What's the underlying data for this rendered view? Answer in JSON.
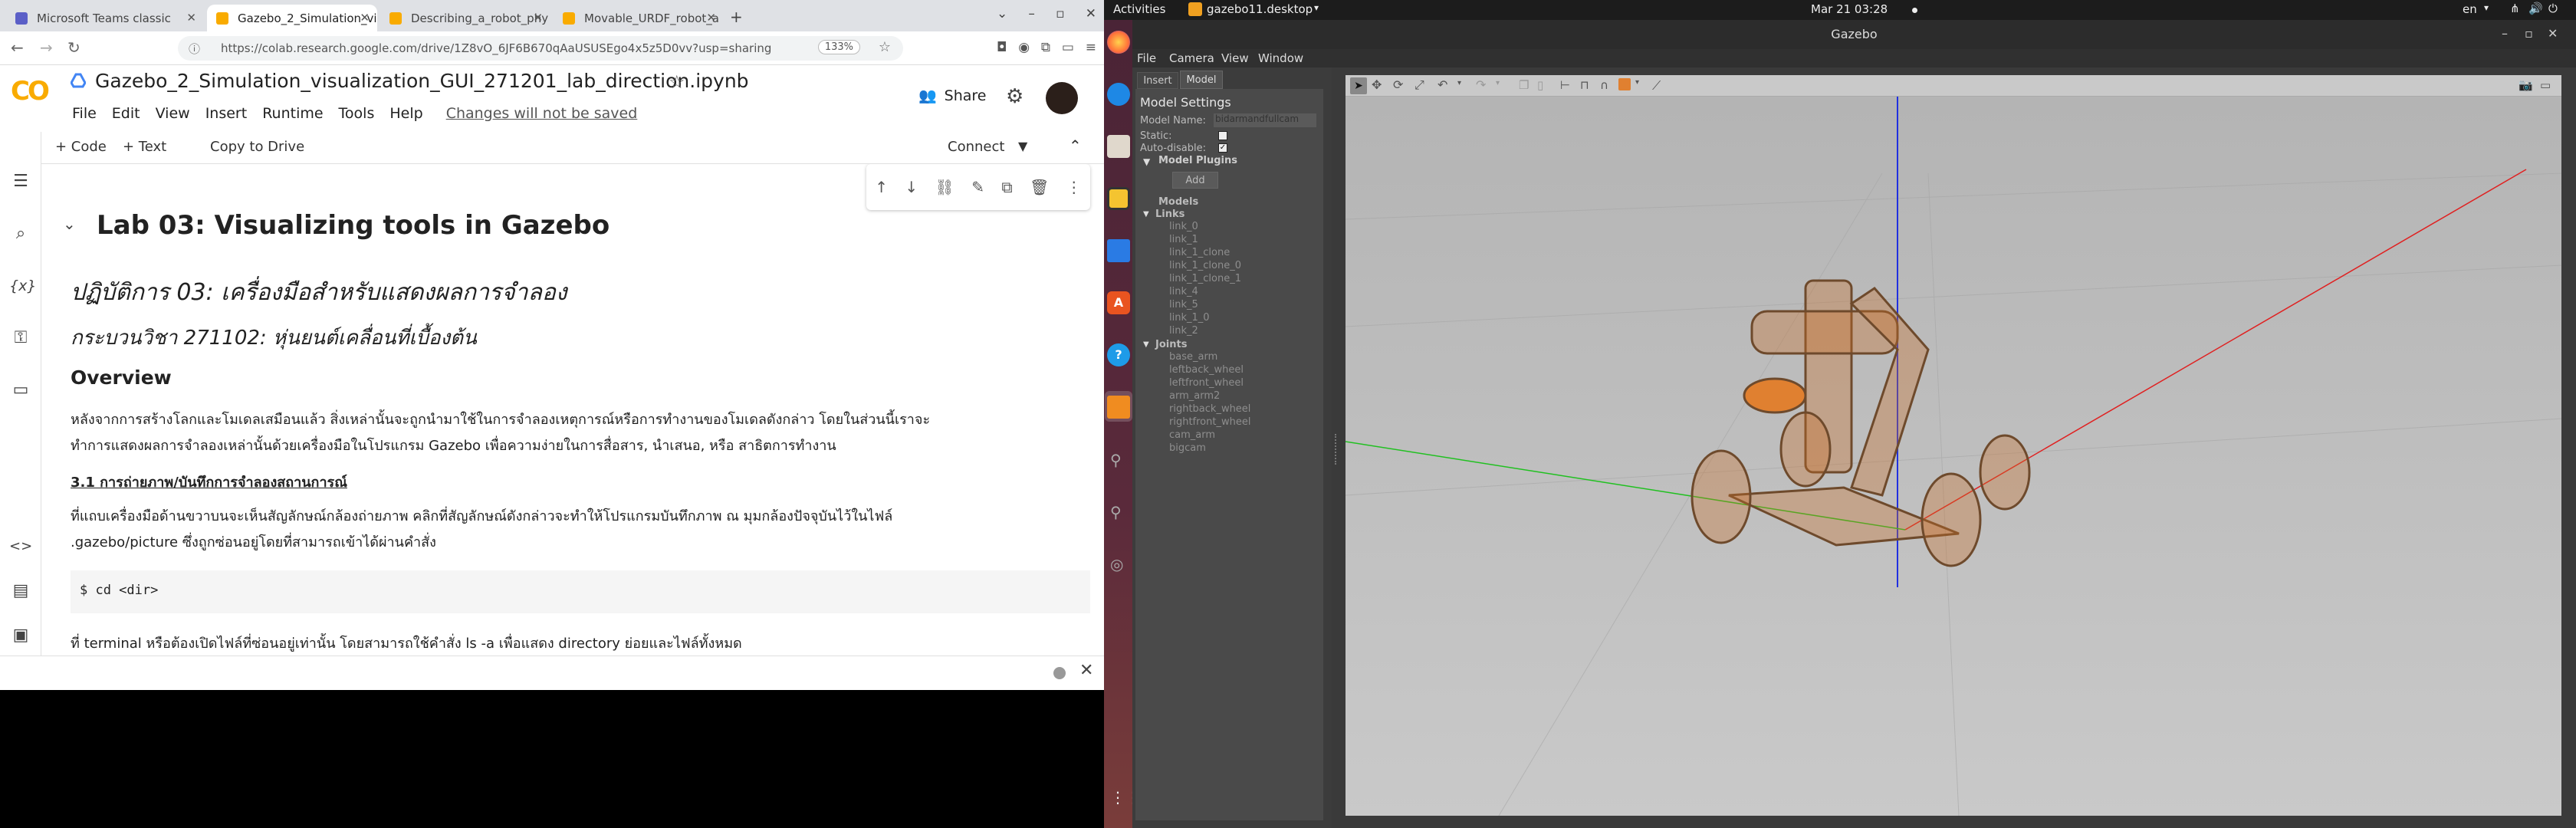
{
  "browser": {
    "tabs": [
      {
        "label": "Microsoft Teams classic",
        "fav_color": "#5b5fc7"
      },
      {
        "label": "Gazebo_2_Simulation_vi",
        "fav_color": "#f9ab00"
      },
      {
        "label": "Describing_a_robot_phy",
        "fav_color": "#f9ab00"
      },
      {
        "label": "Movable_URDF_robot_a",
        "fav_color": "#f9ab00"
      }
    ],
    "url": "https://colab.research.google.com/drive/1Z8vO_6JF6B670qAaUSUSEgo4x5z5D0vv?usp=sharing",
    "zoom": "133%"
  },
  "colab": {
    "logo": "CO",
    "notebook_title": "Gazebo_2_Simulation_visualization_GUI_271201_lab_direction.ipynb",
    "menu": [
      "File",
      "Edit",
      "View",
      "Insert",
      "Runtime",
      "Tools",
      "Help"
    ],
    "unsaved": "Changes will not be saved",
    "share": "Share",
    "add_code": "+ Code",
    "add_text": "+ Text",
    "copy_to_drive": "Copy to Drive",
    "connect": "Connect"
  },
  "notebook": {
    "h1": "Lab 03: Visualizing tools in Gazebo",
    "thai_title": "ปฏิบัติการ 03: เครื่องมือสำหรับแสดงผลการจำลอง",
    "course": "กระบวนวิชา 271102: หุ่นยนต์เคลื่อนที่เบื้องต้น",
    "overview_heading": "Overview",
    "overview_line1": "หลังจากการสร้างโลกและโมเดลเสมือนแล้ว สิ่งเหล่านั้นจะถูกนำมาใช้ในการจำลองเหตุการณ์หรือการทำงานของโมเดลดังกล่าว โดยในส่วนนี้เราจะ",
    "overview_line2": "ทำการแสดงผลการจำลองเหล่านั้นด้วยเครื่องมือในโปรแกรม Gazebo เพื่อความง่ายในการสื่อสาร, นำเสนอ, หรือ สาธิตการทำงาน",
    "section_31": "3.1 การถ่ายภาพ/บันทึกการจำลองสถานการณ์",
    "sec31_line1": "ที่แถบเครื่องมือด้านขวาบนจะเห็นสัญลักษณ์กล้องถ่ายภาพ คลิกที่สัญลักษณ์ดังกล่าวจะทำให้โปรแกรมบันทึกภาพ ณ มุมกล้องปัจจุบันไว้ในไฟล์",
    "sec31_line2": ".gazebo/picture ซึ่งถูกซ่อนอยู่โดยที่สามารถเข้าได้ผ่านคำสั่ง",
    "code": "$ cd <dir>",
    "last_line": "ที่ terminal หรือต้องเปิดไฟล์ที่ซ่อนอยู่เท่านั้น โดยสามารถใช้คำสั่ง ls -a เพื่อแสดง directory ย่อยและไฟล์ทั้งหมด"
  },
  "ubuntu": {
    "activities": "Activities",
    "app": "gazebo11.desktop",
    "clock": "Mar 21  03:28",
    "lang": "en"
  },
  "gazebo": {
    "title": "Gazebo",
    "menu": [
      "File",
      "Camera",
      "View",
      "Window"
    ],
    "tabs": [
      "Insert",
      "Model"
    ],
    "model_settings": "Model Settings",
    "model_name_label": "Model Name:",
    "model_name_value": "bidarmandfullcam",
    "static_label": "Static:",
    "autodisable_label": "Auto-disable:",
    "model_plugins": "Model Plugins",
    "add_button": "Add",
    "models": "Models",
    "links_heading": "Links",
    "links": [
      "link_0",
      "link_1",
      "link_1_clone",
      "link_1_clone_0",
      "link_1_clone_1",
      "link_4",
      "link_5",
      "link_1_0",
      "link_2"
    ],
    "joints_heading": "Joints",
    "joints": [
      "base_arm",
      "leftback_wheel",
      "leftfront_wheel",
      "arm_arm2",
      "rightback_wheel",
      "rightfront_wheel",
      "cam_arm",
      "bigcam"
    ],
    "colors": {
      "axis_x": "#e02020",
      "axis_y": "#20c020",
      "axis_z": "#2030e0",
      "robot": "#c8702a"
    }
  }
}
